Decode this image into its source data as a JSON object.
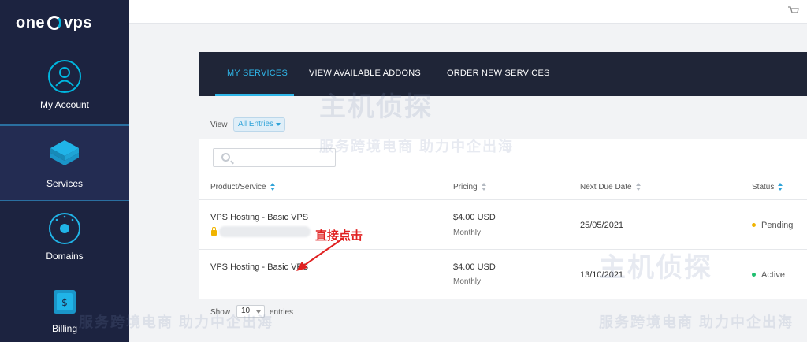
{
  "brand": {
    "logo_left": "one",
    "logo_right": "vps"
  },
  "sidebar": {
    "items": [
      {
        "label": "My Account",
        "icon": "user-icon"
      },
      {
        "label": "Services",
        "icon": "stack-icon"
      },
      {
        "label": "Domains",
        "icon": "globe-icon"
      },
      {
        "label": "Billing",
        "icon": "billing-icon"
      }
    ]
  },
  "tabs": [
    {
      "label": "MY SERVICES",
      "active": true
    },
    {
      "label": "VIEW AVAILABLE ADDONS",
      "active": false
    },
    {
      "label": "ORDER NEW SERVICES",
      "active": false
    }
  ],
  "filter": {
    "view_label": "View",
    "selected": "All Entries"
  },
  "table": {
    "headers": [
      "Product/Service",
      "Pricing",
      "Next Due Date",
      "Status"
    ],
    "rows": [
      {
        "product": "VPS Hosting - Basic VPS",
        "price": "$4.00 USD",
        "cycle": "Monthly",
        "due": "25/05/2021",
        "status": "Pending"
      },
      {
        "product": "VPS Hosting - Basic VPS",
        "price": "$4.00 USD",
        "cycle": "Monthly",
        "due": "13/10/2021",
        "status": "Active"
      }
    ]
  },
  "footer": {
    "show_label": "Show",
    "entries_value": "10",
    "entries_label": "entries"
  },
  "annotation": {
    "text": "直接点击"
  },
  "watermark": {
    "line1": "主机侦探",
    "line2": "服务跨境电商 助力中企出海"
  },
  "colors": {
    "accent": "#2fb6e8",
    "pending": "#f0b400",
    "active": "#1fbf6f",
    "annotation": "#e02020",
    "sidebar": "#1c2340"
  }
}
